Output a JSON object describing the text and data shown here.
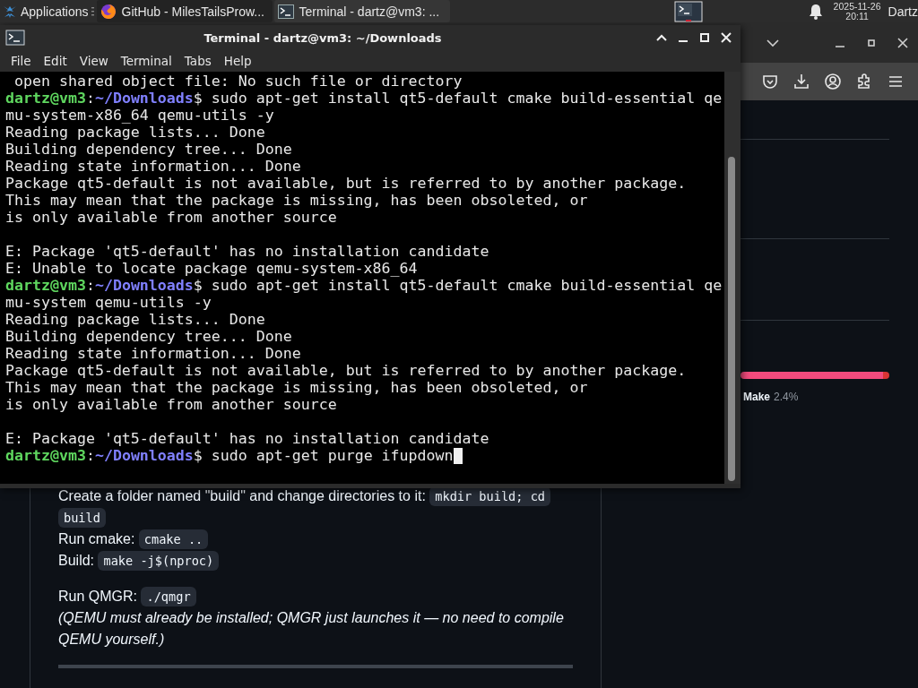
{
  "top_panel": {
    "applications_label": "Applications",
    "taskbar": [
      {
        "label": "GitHub - MilesTailsProw...",
        "kind": "browser",
        "selected": false
      },
      {
        "label": "Terminal - dartz@vm3: ...",
        "kind": "terminal",
        "selected": true
      }
    ],
    "clock": {
      "date": "2025-11-26",
      "time": "20:11"
    },
    "user": "Dartz"
  },
  "browser": {
    "sidebar": {
      "language_bar": [
        {
          "color": "#f34b7d",
          "level": 0.96
        },
        {
          "color": "#da3434",
          "level": 0.04
        }
      ],
      "languages": [
        {
          "name": "Make",
          "share": "2.4%"
        }
      ]
    },
    "readme": {
      "blocks": [
        {
          "lines": [
            [
              {
                "kind": "text",
                "text": "Create a folder named \"build\" and change directories to it: "
              },
              {
                "kind": "code",
                "text": "mkdir build; cd build"
              }
            ],
            [
              {
                "kind": "text",
                "text": "Run cmake: "
              },
              {
                "kind": "code",
                "text": "cmake .."
              }
            ],
            [
              {
                "kind": "text",
                "text": "Build: "
              },
              {
                "kind": "code",
                "text": "make -j$(nproc)"
              }
            ]
          ]
        },
        {
          "lines": [
            [
              {
                "kind": "text",
                "text": "Run QMGR: "
              },
              {
                "kind": "code",
                "text": "./qmgr"
              }
            ],
            [
              {
                "kind": "note",
                "text": "(QEMU must already be installed; QMGR just launches it — no need to compile QEMU yourself.)"
              }
            ]
          ]
        }
      ]
    }
  },
  "terminal": {
    "title": "Terminal - dartz@vm3: ~/Downloads",
    "menu": [
      "File",
      "Edit",
      "View",
      "Terminal",
      "Tabs",
      "Help"
    ],
    "cursor": true,
    "lines": [
      {
        "kind": "output",
        "text": " open shared object file: No such file or directory"
      },
      {
        "kind": "prompt",
        "user": "dartz@vm3",
        "path": "~/Downloads",
        "sep": ":",
        "sign": "$",
        "command": " sudo apt-get install qt5-default cmake build-essential qemu-system-x86_64 qemu-utils -y"
      },
      {
        "kind": "output",
        "text": "Reading package lists... Done"
      },
      {
        "kind": "output",
        "text": "Building dependency tree... Done"
      },
      {
        "kind": "output",
        "text": "Reading state information... Done"
      },
      {
        "kind": "output",
        "text": "Package qt5-default is not available, but is referred to by another package."
      },
      {
        "kind": "output",
        "text": "This may mean that the package is missing, has been obsoleted, or"
      },
      {
        "kind": "output",
        "text": "is only available from another source"
      },
      {
        "kind": "blank"
      },
      {
        "kind": "output",
        "text": "E: Package 'qt5-default' has no installation candidate"
      },
      {
        "kind": "output",
        "text": "E: Unable to locate package qemu-system-x86_64"
      },
      {
        "kind": "prompt",
        "user": "dartz@vm3",
        "path": "~/Downloads",
        "sep": ":",
        "sign": "$",
        "command": " sudo apt-get install qt5-default cmake build-essential qemu-system qemu-utils -y"
      },
      {
        "kind": "output",
        "text": "Reading package lists... Done"
      },
      {
        "kind": "output",
        "text": "Building dependency tree... Done"
      },
      {
        "kind": "output",
        "text": "Reading state information... Done"
      },
      {
        "kind": "output",
        "text": "Package qt5-default is not available, but is referred to by another package."
      },
      {
        "kind": "output",
        "text": "This may mean that the package is missing, has been obsoleted, or"
      },
      {
        "kind": "output",
        "text": "is only available from another source"
      },
      {
        "kind": "blank"
      },
      {
        "kind": "output",
        "text": "E: Package 'qt5-default' has no installation candidate"
      },
      {
        "kind": "prompt",
        "user": "dartz@vm3",
        "path": "~/Downloads",
        "sep": ":",
        "sign": "$",
        "command": " sudo apt-get purge ifupdown"
      }
    ]
  }
}
